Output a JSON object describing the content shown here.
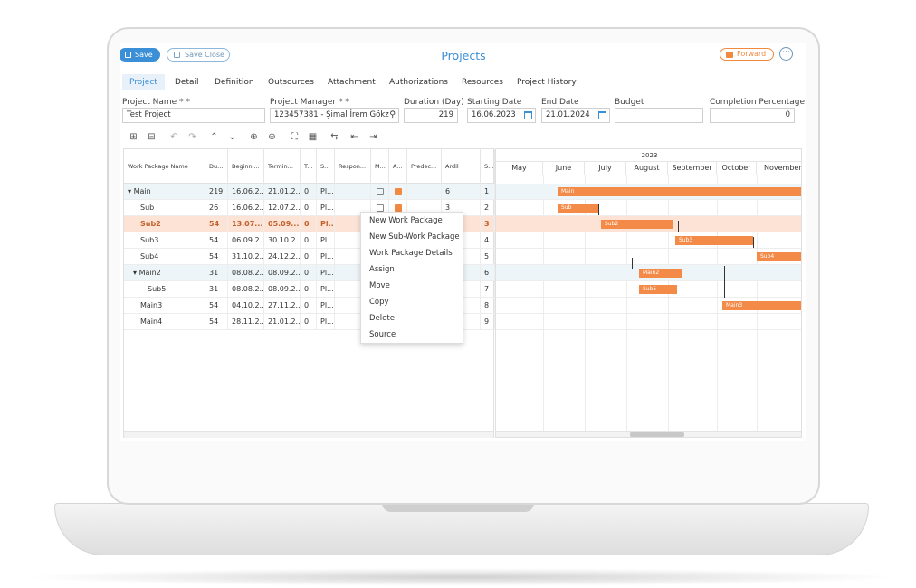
{
  "toolbar": {
    "save": "Save",
    "save_close": "Save Close",
    "forward": "Forward",
    "more": "···"
  },
  "title": "Projects",
  "tabs": [
    "Project",
    "Detail",
    "Definition",
    "Outsources",
    "Attachment",
    "Authorizations",
    "Resources",
    "Project History"
  ],
  "fields": {
    "project_name": {
      "label": "Project Name * *",
      "value": "Test Project"
    },
    "project_manager": {
      "label": "Project Manager * *",
      "value": "123457381 - Şimal İrem Gökz"
    },
    "duration": {
      "label": "Duration (Day)",
      "value": "219"
    },
    "starting_date": {
      "label": "Starting Date",
      "value": "16.06.2023"
    },
    "end_date": {
      "label": "End Date",
      "value": "21.01.2024"
    },
    "budget": {
      "label": "Budget",
      "value": ""
    },
    "completion": {
      "label": "Completion Percentage",
      "value": "0"
    }
  },
  "grid": {
    "columns": [
      "Work Package Name",
      "Du...",
      "Beginni...",
      "Termin...",
      "T...",
      "S...",
      "Respon...",
      "M...",
      "A...",
      "Predec...",
      "Ardil",
      "S..."
    ],
    "rows": [
      {
        "name": "Main",
        "dur": "219",
        "begin": "16.06.2...",
        "term": "21.01.2...",
        "t": "0",
        "s": "Pl...",
        "m": false,
        "a": true,
        "pred": "",
        "ardil": "6",
        "seq": "1"
      },
      {
        "name": "Sub",
        "dur": "26",
        "begin": "16.06.2...",
        "term": "12.07.2...",
        "t": "0",
        "s": "Pl...",
        "m": false,
        "a": true,
        "pred": "",
        "ardil": "3",
        "seq": "2"
      },
      {
        "name": "Sub2",
        "dur": "54",
        "begin": "13.07....",
        "term": "05.09....",
        "t": "0",
        "s": "Pl...",
        "m": false,
        "a": false,
        "pred": "",
        "ardil": "",
        "seq": "3"
      },
      {
        "name": "Sub3",
        "dur": "54",
        "begin": "06.09.2...",
        "term": "30.10.2...",
        "t": "0",
        "s": "Pl...",
        "m": false,
        "a": false,
        "pred": "",
        "ardil": "",
        "seq": "4"
      },
      {
        "name": "Sub4",
        "dur": "54",
        "begin": "31.10.2...",
        "term": "24.12.2...",
        "t": "0",
        "s": "Pl...",
        "m": false,
        "a": false,
        "pred": "",
        "ardil": "",
        "seq": "5"
      },
      {
        "name": "Main2",
        "dur": "31",
        "begin": "08.08.2...",
        "term": "08.09.2...",
        "t": "0",
        "s": "Pl...",
        "m": false,
        "a": false,
        "pred": "",
        "ardil": "",
        "seq": "6"
      },
      {
        "name": "Sub5",
        "dur": "31",
        "begin": "08.08.2...",
        "term": "08.09.2...",
        "t": "0",
        "s": "Pl...",
        "m": false,
        "a": false,
        "pred": "",
        "ardil": "",
        "seq": "7"
      },
      {
        "name": "Main3",
        "dur": "54",
        "begin": "04.10.2...",
        "term": "27.11.2...",
        "t": "0",
        "s": "Pl...",
        "m": false,
        "a": false,
        "pred": "",
        "ardil": "",
        "seq": "8"
      },
      {
        "name": "Main4",
        "dur": "54",
        "begin": "28.11.2...",
        "term": "21.01.2...",
        "t": "0",
        "s": "Pl...",
        "m": false,
        "a": false,
        "pred": "",
        "ardil": "",
        "seq": "9"
      }
    ]
  },
  "context_menu": [
    "New Work Package",
    "New Sub-Work Package",
    "Work Package Details",
    "Assign",
    "Move",
    "Copy",
    "Delete",
    "Source"
  ],
  "gantt": {
    "year": "2023",
    "months": [
      "May",
      "June",
      "July",
      "August",
      "September",
      "October",
      "November"
    ],
    "bars": [
      {
        "label": "Main",
        "row": 0
      },
      {
        "label": "Sub",
        "row": 1
      },
      {
        "label": "Sub2",
        "row": 2
      },
      {
        "label": "Sub3",
        "row": 3
      },
      {
        "label": "Sub4",
        "row": 4
      },
      {
        "label": "Main2",
        "row": 5
      },
      {
        "label": "Sub5",
        "row": 6
      },
      {
        "label": "Main3",
        "row": 7
      }
    ]
  },
  "colors": {
    "accent": "#3a8fd6",
    "bar": "#f48a48",
    "selected_row": "#fde3d6",
    "forward": "#f08a40"
  }
}
